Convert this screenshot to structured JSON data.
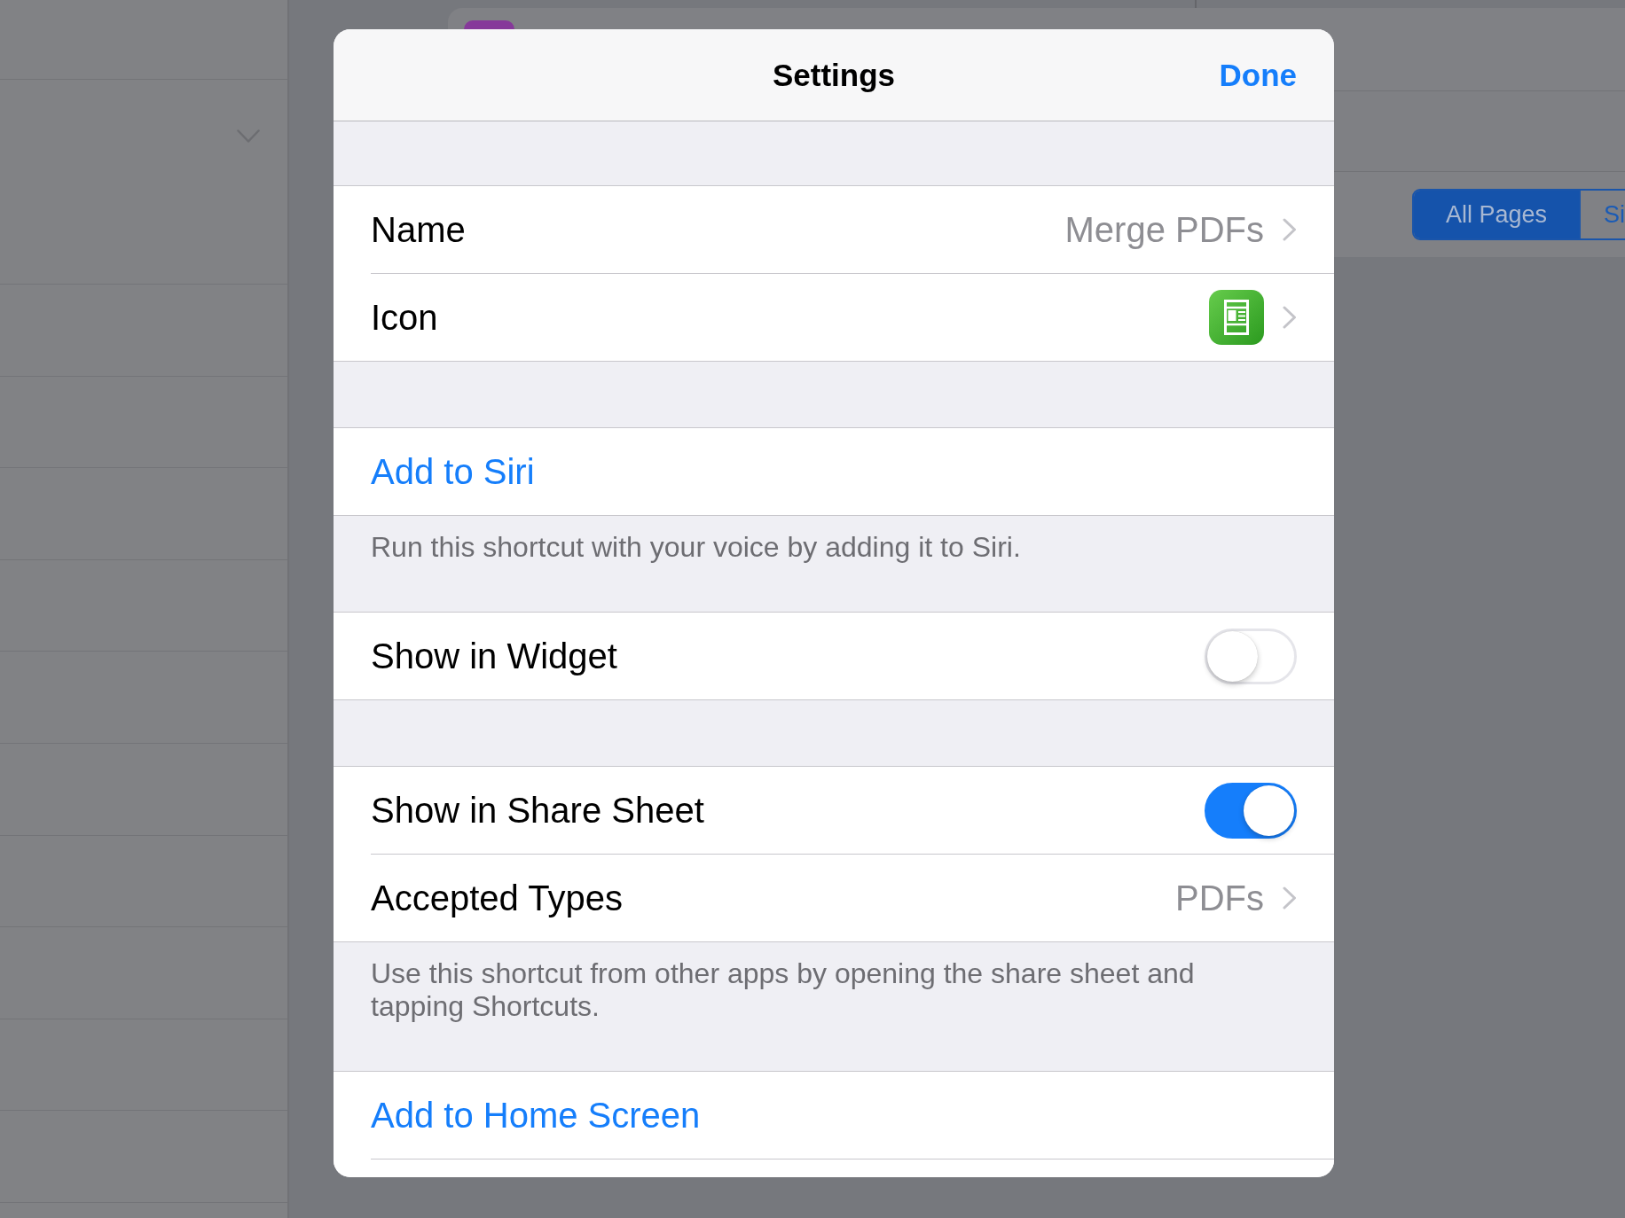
{
  "background_toolbar": {
    "segments": [
      {
        "label": "All Pages",
        "selected": true
      },
      {
        "label": "Si",
        "selected": false
      }
    ]
  },
  "dialog": {
    "title": "Settings",
    "done_button": "Done",
    "sections": [
      {
        "rows": [
          {
            "kind": "link",
            "label": "Name",
            "value": "Merge PDFs"
          },
          {
            "kind": "icon",
            "label": "Icon"
          }
        ]
      },
      {
        "rows": [
          {
            "kind": "action",
            "label": "Add to Siri"
          }
        ],
        "footer": "Run this shortcut with your voice by adding it to Siri."
      },
      {
        "rows": [
          {
            "kind": "toggle",
            "label": "Show in Widget",
            "on": false
          }
        ]
      },
      {
        "rows": [
          {
            "kind": "toggle",
            "label": "Show in Share Sheet",
            "on": true
          },
          {
            "kind": "link",
            "label": "Accepted Types",
            "value": "PDFs"
          }
        ],
        "footer": "Use this shortcut from other apps by opening the share sheet and tapping Shortcuts."
      },
      {
        "rows": [
          {
            "kind": "action",
            "label": "Add to Home Screen"
          }
        ]
      }
    ]
  }
}
